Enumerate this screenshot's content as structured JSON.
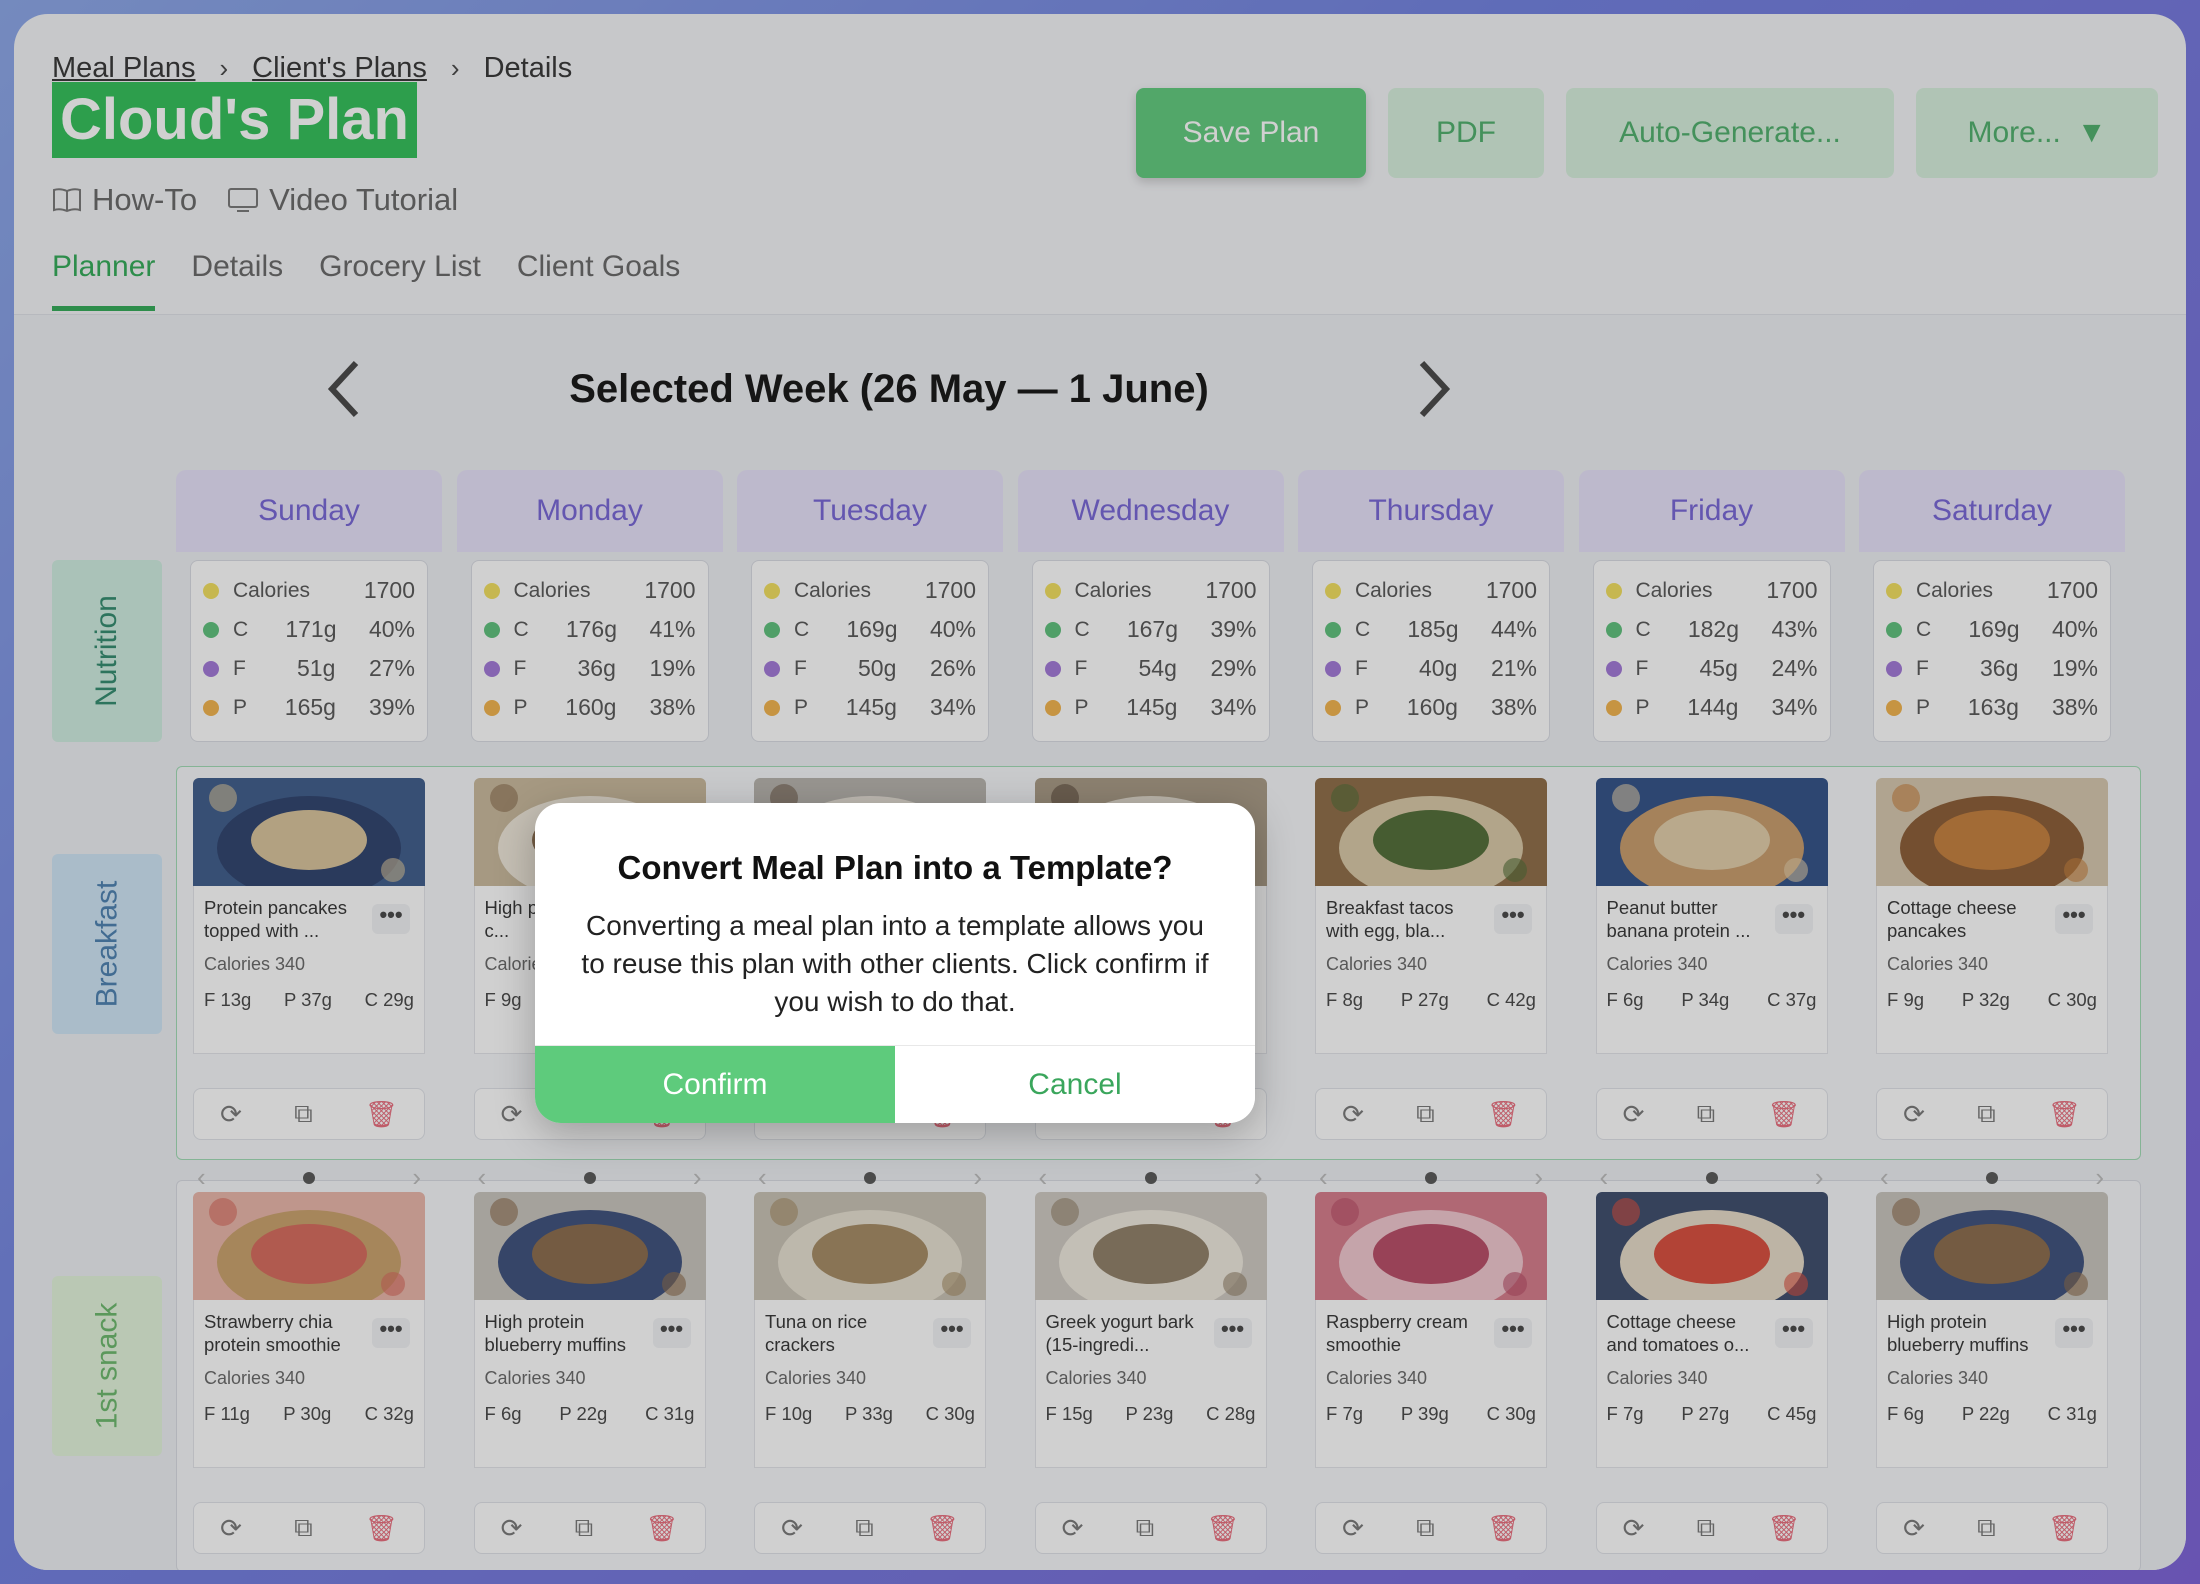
{
  "breadcrumb": [
    "Meal Plans",
    "Client's Plans",
    "Details"
  ],
  "title": "Cloud's Plan",
  "help": {
    "howto": "How-To",
    "video": "Video Tutorial"
  },
  "toolbar": {
    "save": "Save Plan",
    "pdf": "PDF",
    "auto": "Auto-Generate...",
    "more": "More...",
    "more_caret": "▼"
  },
  "tabs": [
    "Planner",
    "Details",
    "Grocery List",
    "Client Goals"
  ],
  "week_label": "Selected Week (26 May — 1 June)",
  "row_labels": {
    "nutrition": "Nutrition",
    "breakfast": "Breakfast",
    "snack": "1st snack"
  },
  "colors": {
    "accent": "#2faa55",
    "calories": "#f3df5c",
    "carbs": "#5cc07a",
    "fat": "#a176d8",
    "protein": "#f2b24a",
    "trash": "#e96a7a"
  },
  "days": [
    {
      "name": "Sunday",
      "nutrition": {
        "calories_label": "Calories",
        "calories": "1700",
        "c": [
          "C",
          "171g",
          "40%"
        ],
        "f": [
          "F",
          "51g",
          "27%"
        ],
        "p": [
          "P",
          "165g",
          "39%"
        ]
      }
    },
    {
      "name": "Monday",
      "nutrition": {
        "calories_label": "Calories",
        "calories": "1700",
        "c": [
          "C",
          "176g",
          "41%"
        ],
        "f": [
          "F",
          "36g",
          "19%"
        ],
        "p": [
          "P",
          "160g",
          "38%"
        ]
      }
    },
    {
      "name": "Tuesday",
      "nutrition": {
        "calories_label": "Calories",
        "calories": "1700",
        "c": [
          "C",
          "169g",
          "40%"
        ],
        "f": [
          "F",
          "50g",
          "26%"
        ],
        "p": [
          "P",
          "145g",
          "34%"
        ]
      }
    },
    {
      "name": "Wednesday",
      "nutrition": {
        "calories_label": "Calories",
        "calories": "1700",
        "c": [
          "C",
          "167g",
          "39%"
        ],
        "f": [
          "F",
          "54g",
          "29%"
        ],
        "p": [
          "P",
          "145g",
          "34%"
        ]
      }
    },
    {
      "name": "Thursday",
      "nutrition": {
        "calories_label": "Calories",
        "calories": "1700",
        "c": [
          "C",
          "185g",
          "44%"
        ],
        "f": [
          "F",
          "40g",
          "21%"
        ],
        "p": [
          "P",
          "160g",
          "38%"
        ]
      }
    },
    {
      "name": "Friday",
      "nutrition": {
        "calories_label": "Calories",
        "calories": "1700",
        "c": [
          "C",
          "182g",
          "43%"
        ],
        "f": [
          "F",
          "45g",
          "24%"
        ],
        "p": [
          "P",
          "144g",
          "34%"
        ]
      }
    },
    {
      "name": "Saturday",
      "nutrition": {
        "calories_label": "Calories",
        "calories": "1700",
        "c": [
          "C",
          "169g",
          "40%"
        ],
        "f": [
          "F",
          "36g",
          "19%"
        ],
        "p": [
          "P",
          "163g",
          "38%"
        ]
      }
    }
  ],
  "breakfast": [
    {
      "name": "Protein pancakes topped with ...",
      "calories": "Calories 340",
      "f": "F 13g",
      "p": "P 37g",
      "c": "C 29g"
    },
    {
      "name": "High protein vegan c...",
      "calories": "Calories 340",
      "f": "F 9g",
      "p": "",
      "c": ""
    },
    {
      "name": "",
      "calories": "",
      "f": "",
      "p": "",
      "c": ""
    },
    {
      "name": "",
      "calories": "",
      "f": "",
      "p": "",
      "c": ""
    },
    {
      "name": "Breakfast tacos with egg, bla...",
      "calories": "Calories 340",
      "f": "F 8g",
      "p": "P 27g",
      "c": "C 42g"
    },
    {
      "name": "Peanut butter banana protein ...",
      "calories": "Calories 340",
      "f": "F 6g",
      "p": "P 34g",
      "c": "C 37g"
    },
    {
      "name": "Cottage cheese pancakes",
      "calories": "Calories 340",
      "f": "F 9g",
      "p": "P 32g",
      "c": "C 30g"
    }
  ],
  "snack": [
    {
      "name": "Strawberry chia protein smoothie",
      "calories": "Calories 340",
      "f": "F 11g",
      "p": "P 30g",
      "c": "C 32g"
    },
    {
      "name": "High protein blueberry muffins",
      "calories": "Calories 340",
      "f": "F 6g",
      "p": "P 22g",
      "c": "C 31g"
    },
    {
      "name": "Tuna on rice crackers",
      "calories": "Calories 340",
      "f": "F 10g",
      "p": "P 33g",
      "c": "C 30g"
    },
    {
      "name": "Greek yogurt bark (15-ingredi...",
      "calories": "Calories 340",
      "f": "F 15g",
      "p": "P 23g",
      "c": "C 28g"
    },
    {
      "name": "Raspberry cream smoothie",
      "calories": "Calories 340",
      "f": "F 7g",
      "p": "P 39g",
      "c": "C 30g"
    },
    {
      "name": "Cottage cheese and tomatoes o...",
      "calories": "Calories 340",
      "f": "F 7g",
      "p": "P 27g",
      "c": "C 45g"
    },
    {
      "name": "High protein blueberry muffins",
      "calories": "Calories 340",
      "f": "F 6g",
      "p": "P 22g",
      "c": "C 31g"
    }
  ],
  "card_actions": {
    "swap": "⟳",
    "copy": "⧉",
    "delete": "🗑",
    "more": "•••",
    "prev": "‹",
    "next": "›"
  },
  "modal": {
    "title": "Convert Meal Plan into a Template?",
    "body": "Converting a meal plan into a template allows you to reuse this plan with other clients. Click confirm if you wish to do that.",
    "confirm": "Confirm",
    "cancel": "Cancel"
  }
}
